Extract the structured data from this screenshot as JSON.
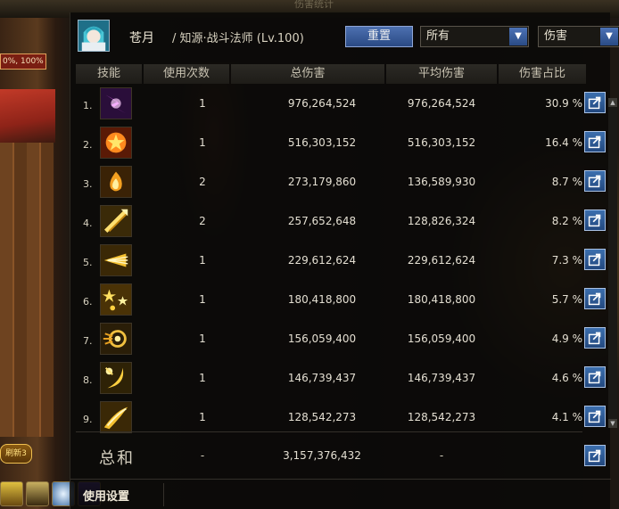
{
  "window": {
    "title": "伤害统计"
  },
  "background": {
    "hp_text": "0%, 100%",
    "event_badge": "刷新3",
    "hotbar_icons": [
      "skill-icon-a",
      "skill-icon-b",
      "skill-icon-c",
      "skill-icon-d"
    ]
  },
  "header": {
    "player_name": "苍月",
    "player_class": "/ 知源·战斗法师 (Lv.100)",
    "reset_label": "重置",
    "filter_target": "所有",
    "filter_metric": "伤害"
  },
  "table": {
    "columns": [
      "技能",
      "使用次数",
      "总伤害",
      "平均伤害",
      "伤害占比"
    ],
    "rows": [
      {
        "rank": "1.",
        "icon": "purple-lightning-icon",
        "uses": "1",
        "total": "976,264,524",
        "avg": "976,264,524",
        "pct": "30.9 %"
      },
      {
        "rank": "2.",
        "icon": "star-burst-icon",
        "uses": "1",
        "total": "516,303,152",
        "avg": "516,303,152",
        "pct": "16.4 %"
      },
      {
        "rank": "3.",
        "icon": "flame-swirl-icon",
        "uses": "2",
        "total": "273,179,860",
        "avg": "136,589,930",
        "pct": "8.7 %"
      },
      {
        "rank": "4.",
        "icon": "spear-thrust-icon",
        "uses": "2",
        "total": "257,652,648",
        "avg": "128,826,324",
        "pct": "8.2 %"
      },
      {
        "rank": "5.",
        "icon": "light-rays-icon",
        "uses": "1",
        "total": "229,612,624",
        "avg": "229,612,624",
        "pct": "7.3 %"
      },
      {
        "rank": "6.",
        "icon": "star-scatter-icon",
        "uses": "1",
        "total": "180,418,800",
        "avg": "180,418,800",
        "pct": "5.7 %"
      },
      {
        "rank": "7.",
        "icon": "orb-vortex-icon",
        "uses": "1",
        "total": "156,059,400",
        "avg": "156,059,400",
        "pct": "4.9 %"
      },
      {
        "rank": "8.",
        "icon": "crescent-slash-icon",
        "uses": "1",
        "total": "146,739,437",
        "avg": "146,739,437",
        "pct": "4.6 %"
      },
      {
        "rank": "9.",
        "icon": "golden-sweep-icon",
        "uses": "1",
        "total": "128,542,273",
        "avg": "128,542,273",
        "pct": "4.1 %"
      }
    ]
  },
  "summary": {
    "label": "总和",
    "uses": "-",
    "total": "3,157,376,432",
    "avg": "-"
  },
  "footer": {
    "tab_settings": "使用设置"
  },
  "colors": {
    "accent_blue": "#2a4a84",
    "gold": "#f2c040"
  }
}
